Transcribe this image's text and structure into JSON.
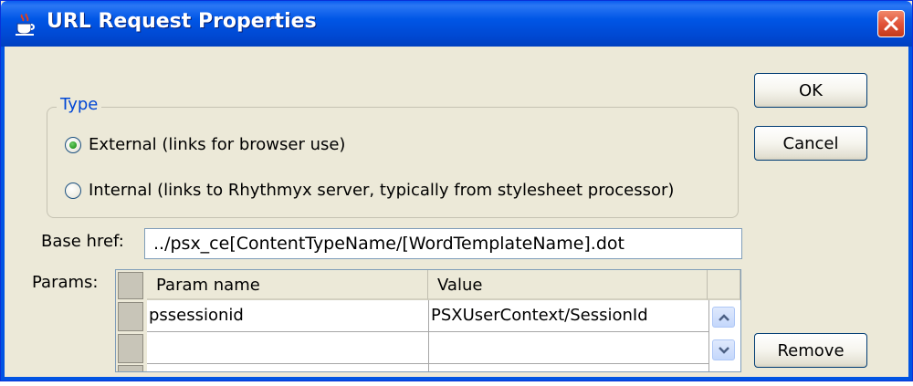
{
  "window": {
    "title": "URL Request Properties"
  },
  "type_group": {
    "label": "Type",
    "options": [
      {
        "label": "External (links for browser use)",
        "selected": true
      },
      {
        "label": "Internal (links to Rhythmyx server, typically from stylesheet processor)",
        "selected": false
      }
    ]
  },
  "base_href": {
    "label": "Base href:",
    "value": "../psx_ce[ContentTypeName/[WordTemplateName].dot"
  },
  "params": {
    "label": "Params:",
    "columns": [
      "Param name",
      "Value"
    ],
    "rows": [
      {
        "name": "pssessionid",
        "value": "PSXUserContext/SessionId"
      },
      {
        "name": "",
        "value": ""
      }
    ]
  },
  "buttons": {
    "ok": "OK",
    "cancel": "Cancel",
    "remove": "Remove"
  },
  "colors": {
    "titlebar": "#0054e3",
    "dialog_bg": "#ece9d8",
    "group_label": "#0046d5",
    "close_button": "#e2543a"
  },
  "icons": {
    "title": "java-cup-icon",
    "close": "close-icon",
    "scroll_up": "chevron-up-icon",
    "scroll_down": "chevron-down-icon"
  }
}
